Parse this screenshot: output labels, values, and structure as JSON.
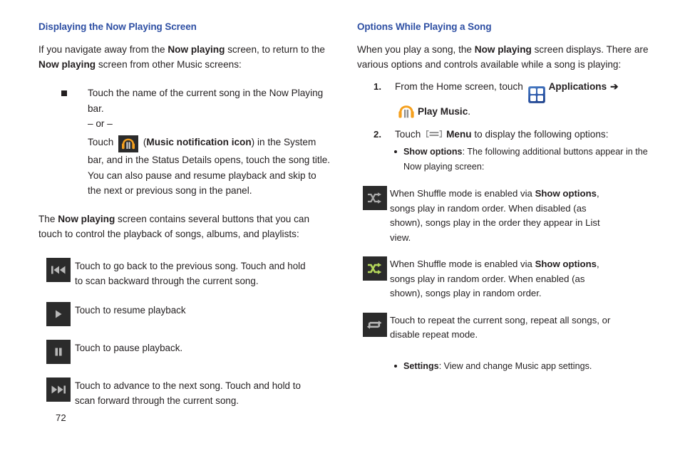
{
  "page": {
    "number": "72"
  },
  "left_column": {
    "heading": "Displaying the Now Playing Screen",
    "intro": {
      "part1": "If you navigate away from the ",
      "bold1": "Now playing",
      "part2": " screen, to return to the ",
      "bold2": "Now playing",
      "part3": " screen from other Music screens:"
    },
    "bullet": {
      "text": "Touch the name of the current song in the Now Playing bar.",
      "or_label": "– or –",
      "alt": {
        "part1": "Touch ",
        "icon_name": "music-notification-icon",
        "part2": " (",
        "bold1": "Music notification icon",
        "part3": ") in the System bar, and in the Status Details opens, touch the song title. You can also pause and resume playback and skip to the next or previous song in the panel."
      }
    },
    "outro": {
      "part1": "The ",
      "bold1": "Now playing",
      "part2": " screen contains several buttons that you can touch to control the playback of songs, albums, and playlists:"
    },
    "controls": [
      {
        "icon": "previous-track-icon",
        "description": "Touch to go back to the previous song. Touch and hold to scan backward through the current song."
      },
      {
        "icon": "play-icon",
        "description": "Touch to resume playback"
      },
      {
        "icon": "pause-icon",
        "description": "Touch to pause playback."
      },
      {
        "icon": "next-track-icon",
        "description": "Touch to advance to the next song. Touch and hold to scan forward through the current song."
      }
    ]
  },
  "right_column": {
    "heading": "Options While Playing a Song",
    "intro": {
      "part1": "When you play a song, the ",
      "bold1": "Now playing",
      "part2": " screen displays. There are various options and controls available while a song is playing:"
    },
    "steps": [
      {
        "number": "1.",
        "part1": "From the Home screen, touch ",
        "icon1": "applications-icon",
        "bold1": "Applications",
        "arrow": "➔",
        "icon2": "play-music-icon",
        "bold2": "Play Music",
        "part2": "."
      },
      {
        "number": "2.",
        "part1": "Touch ",
        "icon1": "menu-icon",
        "bold1": "Menu",
        "part2": " to display the following options:"
      }
    ],
    "show_options": {
      "bold": "Show options",
      "text": ": The following additional buttons appear in the Now playing screen:"
    },
    "option_rows": [
      {
        "icon": "shuffle-disabled-icon",
        "part1": "When Shuffle mode is enabled via ",
        "bold1": "Show options",
        "part2": ", songs play in random order. When disabled (as shown), songs play in the order they appear in List view."
      },
      {
        "icon": "shuffle-enabled-icon",
        "part1": "When Shuffle mode is enabled via ",
        "bold1": "Show options",
        "part2": ", songs play in random order. When enabled (as shown), songs play in random order."
      },
      {
        "icon": "repeat-icon",
        "part1": "Touch to repeat the current song, repeat all songs, or disable repeat mode.",
        "bold1": "",
        "part2": ""
      }
    ],
    "settings": {
      "bold": "Settings",
      "text": ": View and change Music app settings."
    }
  },
  "colors": {
    "heading_blue": "#2e4fa3",
    "body_text": "#231f20",
    "icon_dark_bg": "#2b2b2b",
    "icon_glyph_gray": "#b8b8b8",
    "shuffle_green": "#b4d65a",
    "headphone_orange": "#f5a01e",
    "apps_blue": "#2a56a8"
  }
}
